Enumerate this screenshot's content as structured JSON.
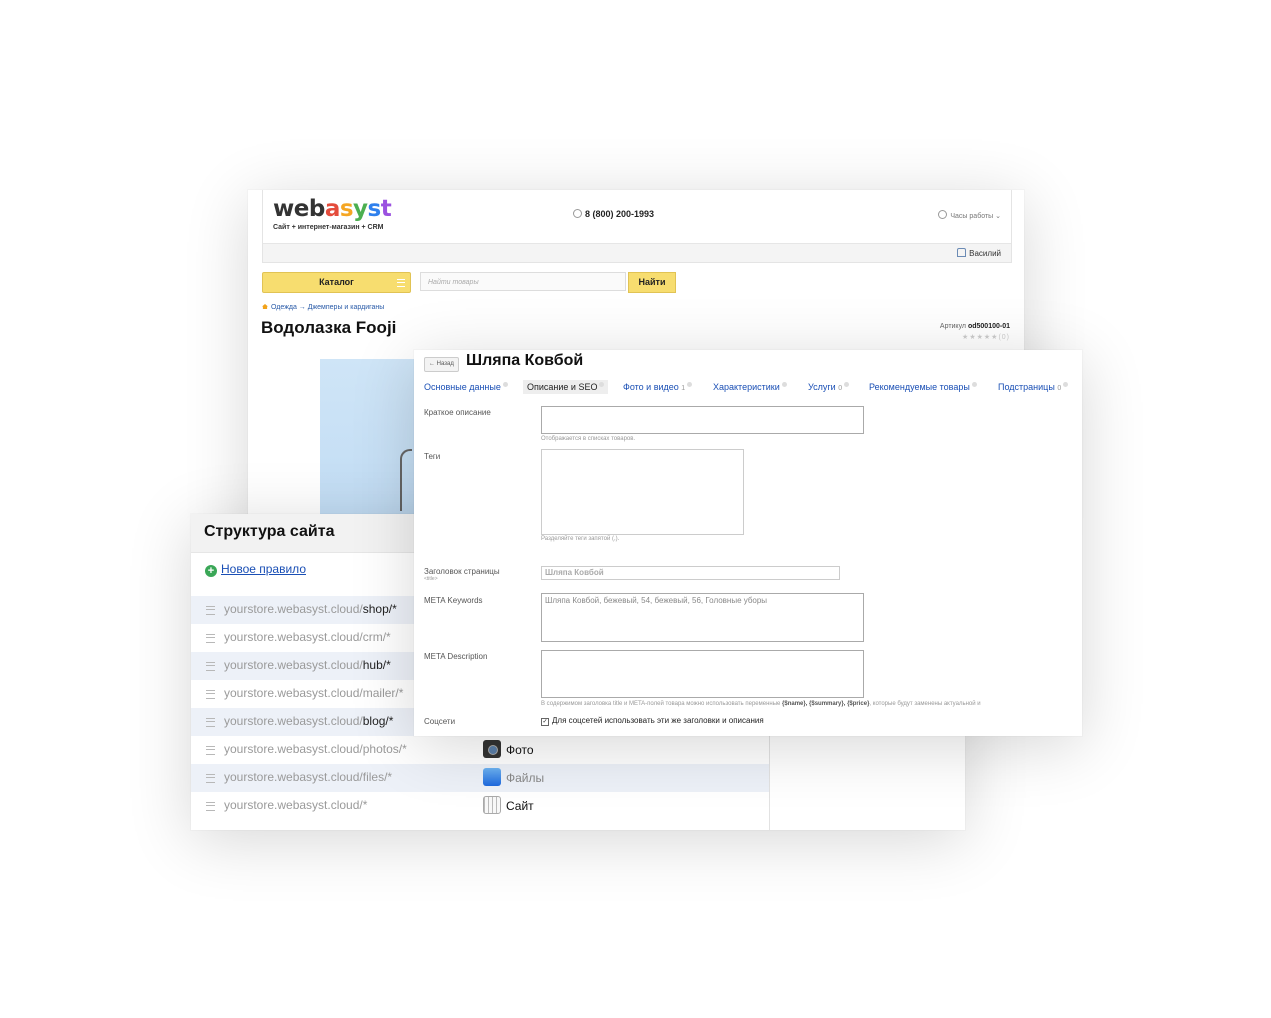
{
  "store": {
    "logo": {
      "w": "web",
      "a": "a",
      "s": "s",
      "y": "y",
      "s2": "s",
      "t": "t"
    },
    "tagline": "Сайт + интернет-магазин + CRM",
    "phone": "8 (800) 200-1993",
    "hours": "Часы работы",
    "user": "Василий",
    "catalog": "Каталог",
    "search_placeholder": "Найти товары",
    "search_button": "Найти",
    "breadcrumb": "Одежда → Джемперы и кардиганы",
    "product_title": "Водолазка Fooji",
    "sku_label": "Артикул",
    "sku_value": "od500100-01",
    "rating_count": "(0)"
  },
  "structure": {
    "title": "Структура сайта",
    "new_rule": "Новое правило",
    "rules": [
      {
        "base": "yourstore.webasyst.cloud/",
        "app": "shop/*"
      },
      {
        "base": "yourstore.webasyst.cloud/crm/*",
        "app": ""
      },
      {
        "base": "yourstore.webasyst.cloud/",
        "app": "hub/*"
      },
      {
        "base": "yourstore.webasyst.cloud/mailer/*",
        "app": ""
      },
      {
        "base": "yourstore.webasyst.cloud/",
        "app": "blog/*"
      },
      {
        "base": "yourstore.webasyst.cloud/photos/*",
        "app": "",
        "app_name": "Фото"
      },
      {
        "base": "yourstore.webasyst.cloud/files/*",
        "app": "",
        "app_name": "Файлы"
      },
      {
        "base": "yourstore.webasyst.cloud/*",
        "app": "",
        "app_name": "Сайт"
      }
    ]
  },
  "editor": {
    "back": "← Назад",
    "title": "Шляпа Ковбой",
    "tabs": [
      {
        "label": "Основные данные",
        "count": ""
      },
      {
        "label": "Описание и SEO",
        "count": ""
      },
      {
        "label": "Фото и видео",
        "count": "1"
      },
      {
        "label": "Характеристики",
        "count": ""
      },
      {
        "label": "Услуги",
        "count": "0"
      },
      {
        "label": "Рекомендуемые товары",
        "count": ""
      },
      {
        "label": "Подстраницы",
        "count": "0"
      }
    ],
    "short_desc_label": "Краткое описание",
    "short_desc_hint": "Отображается в списках товаров.",
    "tags_label": "Теги",
    "tags_hint": "Разделяйте теги запятой (,).",
    "page_title_label": "Заголовок страницы",
    "page_title_sub": "<title>",
    "page_title_value": "Шляпа Ковбой",
    "meta_keywords_label": "META Keywords",
    "meta_keywords_value": "Шляпа Ковбой, бежевый, 54, бежевый, 56, Головные уборы",
    "meta_description_label": "META Description",
    "meta_hint_pre": "В содержимом заголовка title и META-полей товара можно использовать переменные ",
    "meta_hint_vars": "{$name}, {$summary}, {$price}",
    "meta_hint_post": ", которые будут заменены актуальной и",
    "social_label": "Соцсети",
    "social_check": "Для соцсетей использовать эти же заголовки и описания"
  }
}
